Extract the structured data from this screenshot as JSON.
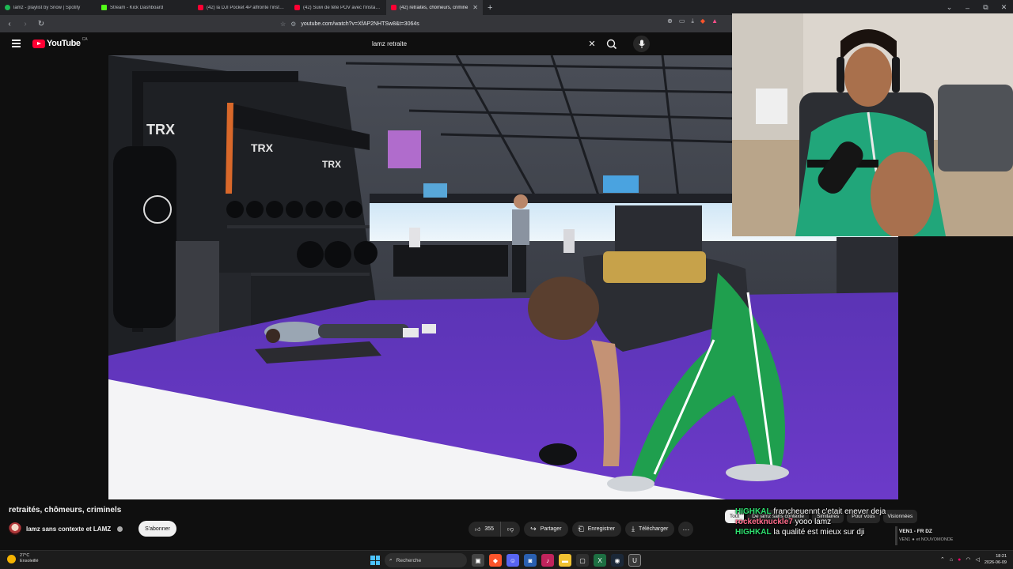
{
  "browser": {
    "tabs": [
      {
        "label": "lamz - playlist by Snow | Spotify",
        "color": "#1db954",
        "active": false
      },
      {
        "label": "Stream - Kick Dashboard",
        "color": "#53fc18",
        "active": false
      },
      {
        "label": "(42) la DJI Pocket 4P affronte l'insta3...",
        "color": "#ff0033",
        "active": false
      },
      {
        "label": "(42) Suivi de tête POV avec l'Insta360...",
        "color": "#ff0033",
        "active": false
      },
      {
        "label": "(42) retraités, chômeurs, crimine",
        "color": "#ff0033",
        "active": true
      }
    ],
    "new_tab": "+",
    "url": "youtube.com/watch?v=XfAP2NHTSw8&t=3064s",
    "window_controls": [
      "⌄",
      "–",
      "⧉",
      "✕"
    ]
  },
  "youtube": {
    "logo_text": "YouTube",
    "country": "CA",
    "search_query": "lamz retraite",
    "clear_glyph": "✕"
  },
  "video_info": {
    "title": "retraités, chômeurs, criminels",
    "channel": "lamz sans contexte et LAMZ",
    "subscribe_label": "S'abonner",
    "like_count": "355",
    "share_label": "Partager",
    "save_label": "Enregistrer",
    "download_label": "Télécharger",
    "more_glyph": "···"
  },
  "chips": [
    {
      "label": "Tout",
      "selected": true
    },
    {
      "label": "De lamz sans contexte",
      "selected": false
    },
    {
      "label": "Similaires",
      "selected": false
    },
    {
      "label": "Pour vous",
      "selected": false
    },
    {
      "label": "Visionnées",
      "selected": false
    }
  ],
  "chat": [
    {
      "user": "HIGHKAL",
      "message": "francheuennt c'etait enever deja",
      "color": "green"
    },
    {
      "user": "rocketknuckle7",
      "message": "yooo lamz",
      "color": "red"
    },
    {
      "user": "HIGHKAL",
      "message": "la qualité est mieux sur dji",
      "color": "green"
    }
  ],
  "recommendation": {
    "title": "VEN1 - FR DZ",
    "channel_prefix": "VEN1",
    "channel_suffix": "et NOUVOMONDE"
  },
  "taskbar": {
    "temperature": "27°C",
    "weather": "Ensoleillé",
    "search_label": "Recherche",
    "time": "18:21",
    "date": "2026-06-09"
  },
  "colors": {
    "youtube_red": "#ff0033",
    "chat_green": "#2ee06f",
    "chat_red": "#ff6a8a",
    "gym_floor": "#6a35c2"
  }
}
